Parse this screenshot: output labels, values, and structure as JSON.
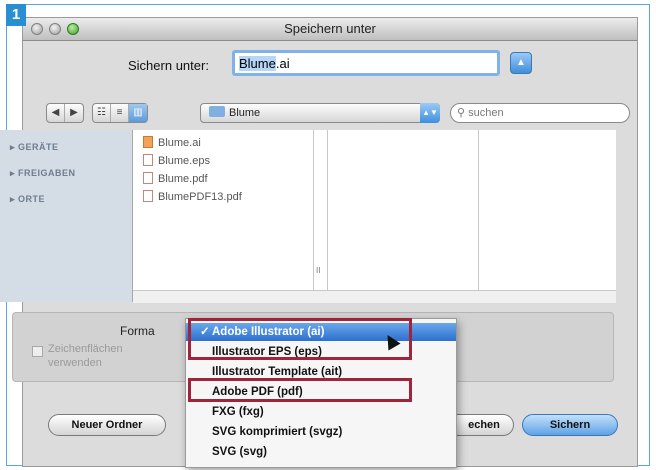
{
  "step_number": "1",
  "window": {
    "title": "Speichern unter"
  },
  "save_as": {
    "label": "Sichern unter:",
    "value_selected": "Blume",
    "value_rest": ".ai"
  },
  "toolbar": {
    "back": "◀",
    "forward": "▶",
    "view_icons": "☷",
    "view_list": "≡",
    "view_columns": "▥",
    "location": "Blume",
    "search_placeholder": "suchen"
  },
  "sidebar": {
    "items": [
      "▸ GERÄTE",
      "▸ FREIGABEN",
      "▸ ORTE"
    ]
  },
  "files": [
    {
      "name": "Blume.ai",
      "type": "ai"
    },
    {
      "name": "Blume.eps",
      "type": "doc"
    },
    {
      "name": "Blume.pdf",
      "type": "doc"
    },
    {
      "name": "BlumePDF13.pdf",
      "type": "doc"
    }
  ],
  "scroll_marker": "II",
  "format": {
    "label": "Forma",
    "options": [
      {
        "label": "Adobe Illustrator (ai)",
        "checked": true,
        "highlighted": true
      },
      {
        "label": "Illustrator EPS (eps)"
      },
      {
        "label": "Illustrator Template (ait)"
      },
      {
        "label": "Adobe PDF (pdf)"
      },
      {
        "label": "FXG (fxg)"
      },
      {
        "label": "SVG komprimiert (svgz)"
      },
      {
        "label": "SVG (svg)"
      }
    ],
    "check_mark": "✓"
  },
  "artboards_checkbox": {
    "label": "Zeichenflächen verwenden"
  },
  "buttons": {
    "new_folder": "Neuer Ordner",
    "cancel": "echen",
    "save": "Sichern"
  },
  "colors": {
    "accent": "#2d6fcf",
    "highlight_box": "#a0243b",
    "step_badge": "#2a8fd0"
  }
}
